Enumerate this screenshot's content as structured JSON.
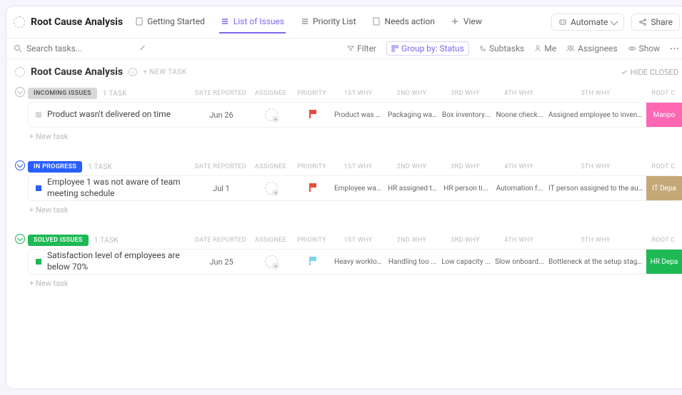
{
  "header": {
    "title": "Root Cause Analysis",
    "views": [
      {
        "label": "Getting Started"
      },
      {
        "label": "List of Issues"
      },
      {
        "label": "Priority List"
      },
      {
        "label": "Needs action"
      },
      {
        "label": "View"
      }
    ],
    "automate": "Automate",
    "share": "Share"
  },
  "toolbar": {
    "search_placeholder": "Search tasks...",
    "filter": "Filter",
    "group_by": "Group by: Status",
    "subtasks": "Subtasks",
    "me": "Me",
    "assignees": "Assignees",
    "show": "Show"
  },
  "list": {
    "title": "Root Cause Analysis",
    "new_task": "+ NEW TASK",
    "hide_closed": "HIDE CLOSED",
    "add_task": "+ New task"
  },
  "columns": {
    "date": "DATE REPORTED",
    "assignee": "ASSIGNEE",
    "priority": "PRIORITY",
    "w1": "1ST WHY",
    "w2": "2ND WHY",
    "w3": "3RD WHY",
    "w4": "4TH WHY",
    "w5": "5TH WHY",
    "root": "ROOT C"
  },
  "groups": [
    {
      "name": "INCOMING ISSUES",
      "count": "1 TASK",
      "color": "gray",
      "tasks": [
        {
          "name": "Product wasn't delivered on time",
          "date": "Jun 26",
          "priority": "red",
          "w1": "Product was not re...",
          "w2": "Packaging wa...",
          "w3": "Box inventory...",
          "w4": "Noone check...",
          "w5": "Assigned employee to inventory che...",
          "root": "Manpo",
          "root_color": "pink"
        }
      ]
    },
    {
      "name": "IN PROGRESS",
      "count": "1 TASK",
      "color": "blue",
      "tasks": [
        {
          "name": "Employee 1 was not aware of team meeting schedule",
          "date": "Jul 1",
          "priority": "red",
          "w1": "Employee was not ...",
          "w2": "HR assigned t...",
          "w3": "HR person ti...",
          "w4": "Automation f...",
          "w5": "IT person assigned to the automatio...",
          "root": "IT Depa",
          "root_color": "tan"
        }
      ]
    },
    {
      "name": "SOLVED ISSUES",
      "count": "1 TASK",
      "color": "green",
      "tasks": [
        {
          "name": "Satisfaction level of employees are below 70%",
          "date": "Jun 25",
          "priority": "cyan",
          "w1": "Heavy workload",
          "w2": "Handling too ...",
          "w3": "Low capacity ...",
          "w4": "Slow onboard...",
          "w5": "Bottleneck at the setup stage of onb...",
          "root": "HR Depa",
          "root_color": "grn"
        }
      ]
    }
  ]
}
